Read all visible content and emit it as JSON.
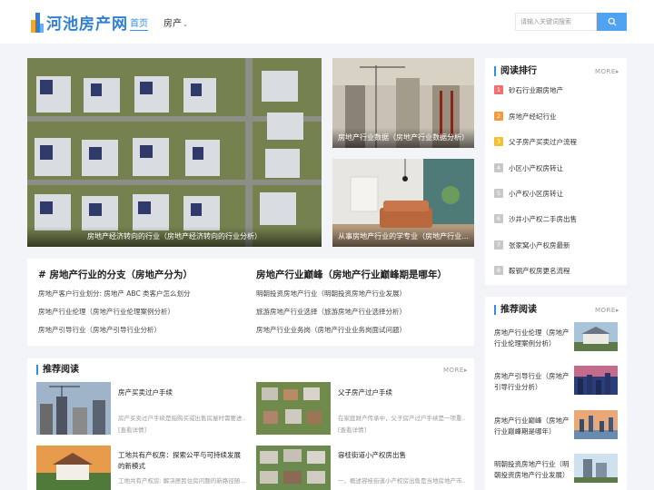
{
  "header": {
    "logo_text": "河池房产网",
    "nav": {
      "home": "首页",
      "realty": "房产"
    },
    "search_placeholder": "请输入关键词搜索"
  },
  "hero": {
    "main_caption": "房地产经济转向的行业（房地产经济转向的行业分析）",
    "top_right_caption": "房地产行业数据（房地产行业数据分析）",
    "bottom_right_caption": "从事房地产行业的学专业（房地产行业..."
  },
  "articles": {
    "left": {
      "title": "# 房地产行业的分支（房地产分为）",
      "items": [
        "房地产客户行业划分: 房地产 ABC 类客户怎么划分",
        "房地产行业伦理（房地产行业伦理案例分析）",
        "房地产引导行业（房地产引导行业分析）"
      ]
    },
    "right": {
      "title": "房地产行业巅峰（房地产行业巅峰期是哪年）",
      "items": [
        "明朝投资房地产行业（明朝投资房地产行业发展）",
        "旅游房地产行业选择（旅游房地产行业选择分析）",
        "房地产行业业务岗（房地产行业业务岗面试问题）"
      ]
    }
  },
  "featured": {
    "title": "推荐阅读",
    "more": "MORE",
    "items": [
      {
        "title": "房产买卖过户手续",
        "desc": "房产买卖过户手续是指购买或出售房屋时需要进...",
        "link": "[查看详情]"
      },
      {
        "title": "父子房产过户手续",
        "desc": "在家庭财产传承中，父子房产过户手续是一项重...",
        "link": "[查看详情]"
      },
      {
        "title": "工地共有产权房：探索公平与可持续发展的新模式",
        "desc": "工地共有产权房: 解决居民住房问题的新路径随..."
      },
      {
        "title": "容桂街道小产权房出售",
        "desc": "一、概述容桂街道小产权房出售是当地房地产市..."
      }
    ]
  },
  "ranking": {
    "title": "阅读排行",
    "more": "MORE",
    "items": [
      {
        "num": "1",
        "label": "砂石行业跟房地产",
        "color": "#f07070"
      },
      {
        "num": "2",
        "label": "房地产经纪行业",
        "color": "#f59a3c"
      },
      {
        "num": "3",
        "label": "父子房产买卖过户流程",
        "color": "#f5c030"
      },
      {
        "num": "4",
        "label": "小区小产权房转让",
        "color": "#c8c8c8"
      },
      {
        "num": "5",
        "label": "小产权小区房转让",
        "color": "#c8c8c8"
      },
      {
        "num": "6",
        "label": "沙井小产权二手房出售",
        "color": "#c8c8c8"
      },
      {
        "num": "7",
        "label": "张家窝小产权房最新",
        "color": "#c8c8c8"
      },
      {
        "num": "8",
        "label": "鞍钢产权房更名流程",
        "color": "#c8c8c8"
      }
    ]
  },
  "recommend": {
    "title": "推荐阅读",
    "more": "MORE",
    "items": [
      {
        "label": "房地产行业伦理（房地产行业伦理案例分析）"
      },
      {
        "label": "房地产引导行业（房地产引导行业分析）"
      },
      {
        "label": "房地产行业巅峰（房地产行业巅峰期是哪年）"
      },
      {
        "label": "明朝投资房地产行业（明朝投资房地产行业发展）"
      }
    ]
  },
  "colors": {
    "accent": "#2f8ee8",
    "search_button": "#4fa3f0"
  },
  "icons": {
    "search": "search-icon",
    "chevron": "chevron-down-icon",
    "more": "chevron-right-icon"
  }
}
